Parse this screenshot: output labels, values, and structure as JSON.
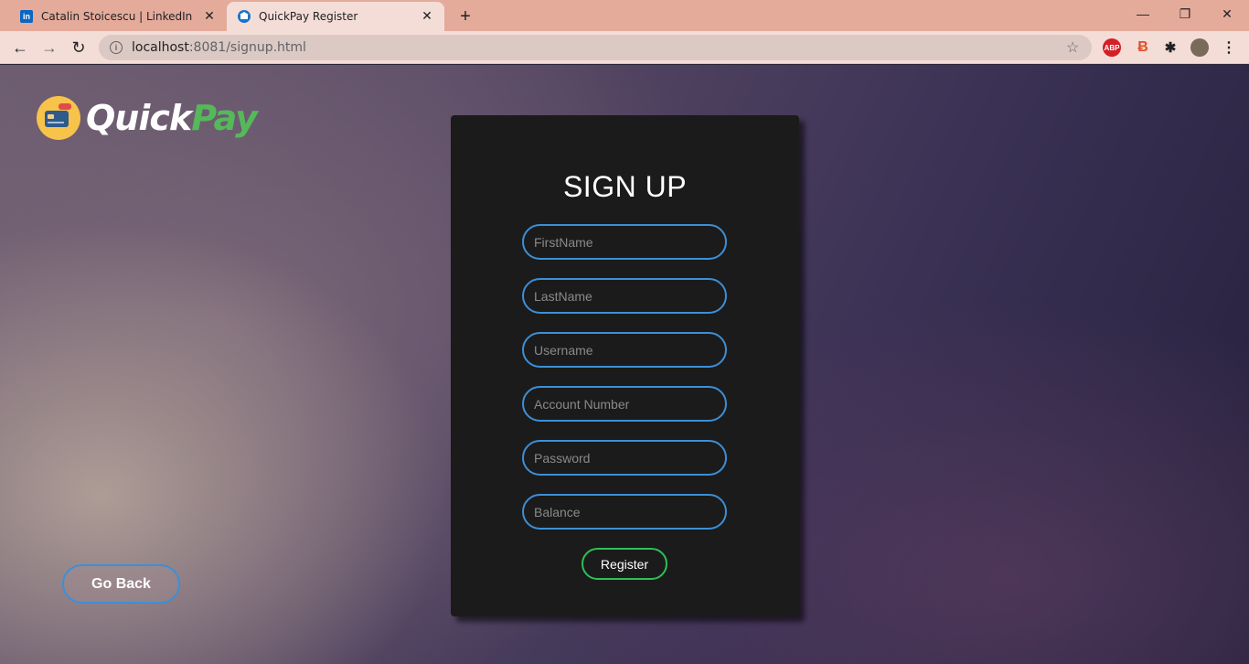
{
  "browser": {
    "tabs": [
      {
        "title": "Catalin Stoicescu | LinkedIn",
        "favicon": "linkedin-icon",
        "favicon_text": "in",
        "active": false
      },
      {
        "title": "QuickPay Register",
        "favicon": "quickpay-favicon-icon",
        "active": true
      }
    ],
    "close_glyph": "✕",
    "new_tab_glyph": "+",
    "window_controls": {
      "minimize": "—",
      "maximize": "❐",
      "close": "✕"
    },
    "nav": {
      "back": "←",
      "forward": "→",
      "reload": "↻"
    },
    "address": {
      "host": "localhost",
      "rest": ":8081/signup.html"
    },
    "star_glyph": "☆",
    "extensions": {
      "abp": "ABP",
      "b": "Ƀ",
      "puzzle": "✱",
      "menu": "⋮"
    },
    "colors": {
      "tabbar": "#e4ab9b",
      "active_tab": "#f4ddd7"
    }
  },
  "logo": {
    "quick": "Quick",
    "pay": "Pay"
  },
  "go_back_label": "Go Back",
  "form": {
    "title": "SIGN UP",
    "fields": [
      {
        "placeholder": "FirstName",
        "value": ""
      },
      {
        "placeholder": "LastName",
        "value": ""
      },
      {
        "placeholder": "Username",
        "value": ""
      },
      {
        "placeholder": "Account Number",
        "value": ""
      },
      {
        "placeholder": "Password",
        "value": ""
      },
      {
        "placeholder": "Balance",
        "value": ""
      }
    ],
    "submit_label": "Register"
  },
  "colors": {
    "card_bg": "#1b1b1b",
    "field_border": "#3d8fd6",
    "register_border": "#2fbf58",
    "logo_pay": "#55b95a",
    "logo_badge": "#f7c34a"
  }
}
